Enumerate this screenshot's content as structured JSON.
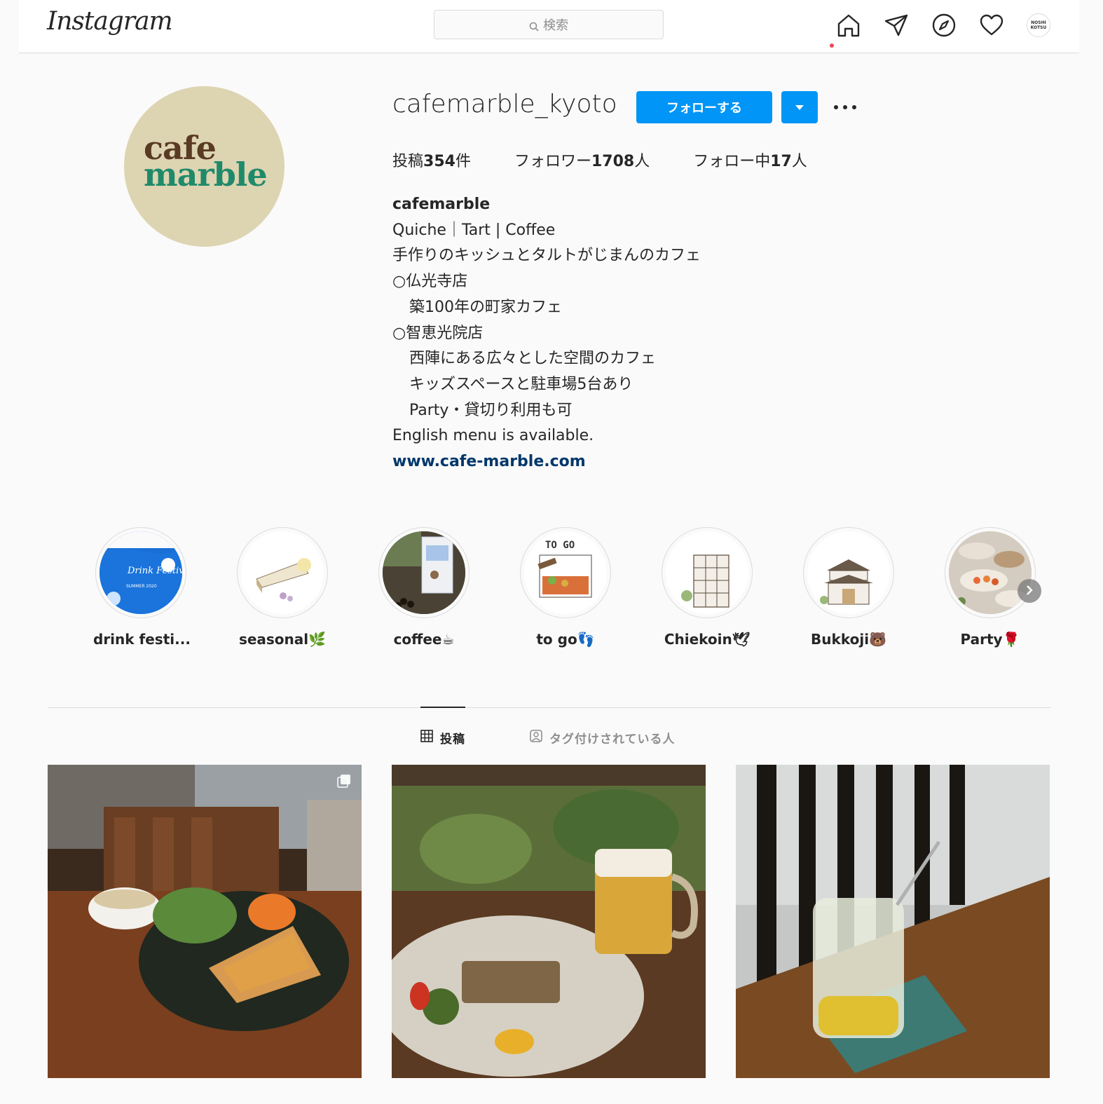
{
  "nav": {
    "logo": "Instagram",
    "search_placeholder": "検索",
    "avatar_text": "NOSHI KOTSU"
  },
  "profile": {
    "username": "cafemarble_kyoto",
    "follow_label": "フォローする",
    "avatar_word1": "cafe",
    "avatar_word2": "marble",
    "stats": {
      "posts_prefix": "投稿",
      "posts_count": "354",
      "posts_suffix": "件",
      "followers_prefix": "フォロワー",
      "followers_count": "1708",
      "followers_suffix": "人",
      "following_prefix": "フォロー中",
      "following_count": "17",
      "following_suffix": "人"
    },
    "bio": {
      "name": "cafemarble",
      "line1": "Quiche｜Tart | Coffee",
      "line2": "手作りのキッシュとタルトがじまんのカフェ",
      "line3": "○仏光寺店",
      "line4": "築100年の町家カフェ",
      "line5": "○智恵光院店",
      "line6": "西陣にある広々とした空間のカフェ",
      "line7": "キッズスペースと駐車場5台あり",
      "line8": "Party・貸切り利用も可",
      "line9": "English menu is available.",
      "link": "www.cafe-marble.com"
    }
  },
  "highlights": [
    {
      "label": "drink festi..."
    },
    {
      "label": "seasonal🌿"
    },
    {
      "label": "coffee☕"
    },
    {
      "label": "to go👣"
    },
    {
      "label": "Chiekoin🕊"
    },
    {
      "label": "Bukkoji🐻"
    },
    {
      "label": "Party🌹"
    }
  ],
  "highlight_art": {
    "h1_title": "Drink Festival",
    "h1_sub": "SUMMER 2020",
    "h4_title": "TO GO"
  },
  "tabs": {
    "posts": "投稿",
    "tagged": "タグ付けされている人"
  },
  "colors": {
    "accent": "#0095f6",
    "link": "#00376b",
    "notification": "#ed4956"
  }
}
